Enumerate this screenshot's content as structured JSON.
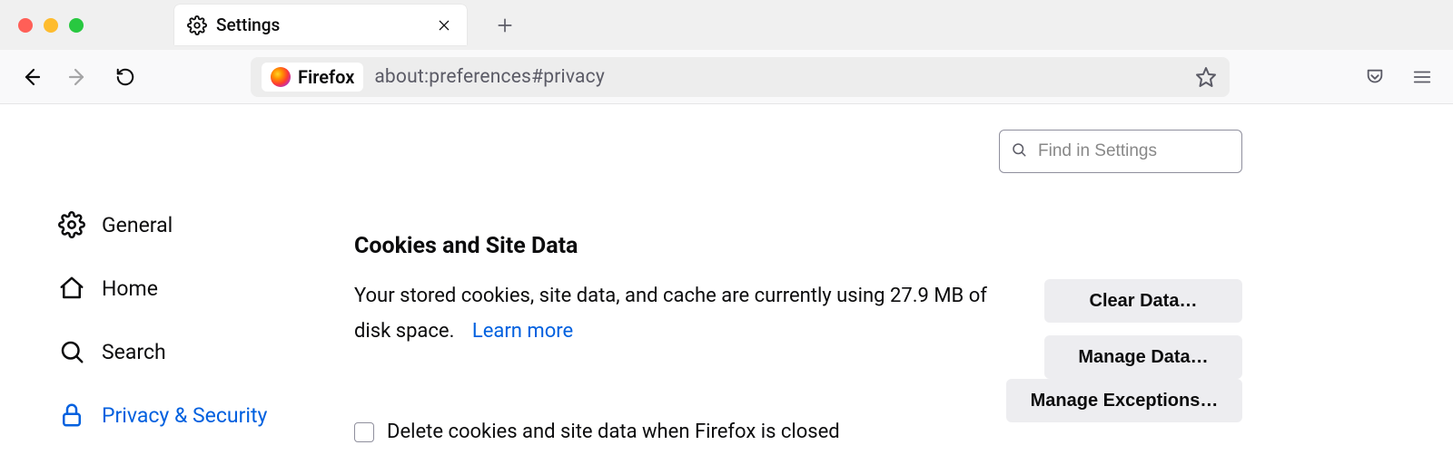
{
  "window": {
    "tab_title": "Settings"
  },
  "toolbar": {
    "identity_label": "Firefox",
    "url": "about:preferences#privacy"
  },
  "search": {
    "placeholder": "Find in Settings"
  },
  "sidebar": {
    "items": [
      {
        "label": "General"
      },
      {
        "label": "Home"
      },
      {
        "label": "Search"
      },
      {
        "label": "Privacy & Security"
      }
    ]
  },
  "main": {
    "section_title": "Cookies and Site Data",
    "description_prefix": "Your stored cookies, site data, and cache are currently using ",
    "usage": "27.9 MB",
    "description_suffix": " of disk space.",
    "learn_more": "Learn more",
    "checkbox_label": "Delete cookies and site data when Firefox is closed",
    "buttons": {
      "clear": "Clear Data…",
      "manage": "Manage Data…",
      "exceptions": "Manage Exceptions…"
    }
  }
}
